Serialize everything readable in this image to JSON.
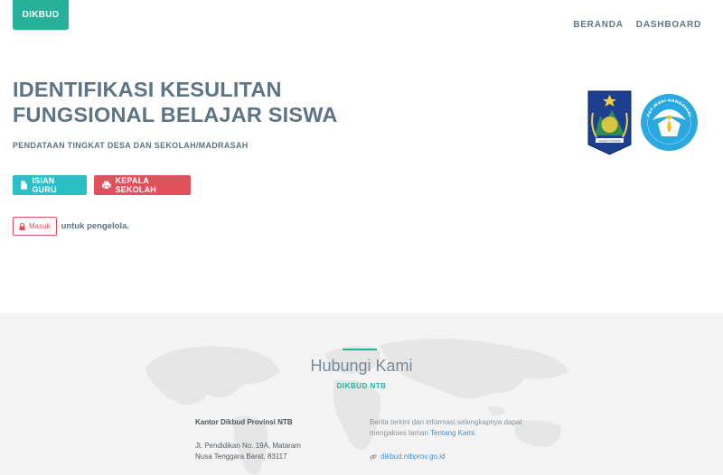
{
  "brand": {
    "label": "DIKBUD"
  },
  "nav": {
    "items": [
      "BERANDA",
      "DASHBOARD"
    ]
  },
  "hero": {
    "title_line1": "IDENTIFIKASI KESULITAN",
    "title_line2": "FUNGSIONAL BELAJAR SISWA",
    "subtitle": "PENDATAAN TINGKAT DESA DAN SEKOLAH/MADRASAH",
    "buttons": {
      "guru": "ISIAN GURU",
      "kepala": "KEPALA SEKOLAH"
    },
    "login": {
      "button": "Masuk",
      "text": "untuk pengelola."
    }
  },
  "logos": {
    "ntb_motto": "TAKTAK TOTAKTIK",
    "tutwuri_text": "TUT WURI HANDAYANI"
  },
  "footer": {
    "heading": "Hubungi Kami",
    "org": "DIKBUD NTB",
    "office": {
      "name": "Kantor Dikbud Provinsi NTB",
      "address_line1": "Jl. Pendidikan No. 19A, Mataram",
      "address_line2": "Nusa Tenggara Barat, 83117"
    },
    "info": {
      "text_line1": "Berita terkini dan informasi selengkapnya dapat",
      "text_prefix": "mengakses laman ",
      "link_text": "Tentang Kami",
      "text_suffix": ".",
      "website": "dikbud.ntbprov.go.id"
    }
  },
  "colors": {
    "accent": "#27b09a",
    "danger": "#e0505d",
    "info": "#2bc0c8",
    "text": "#5e7482"
  }
}
